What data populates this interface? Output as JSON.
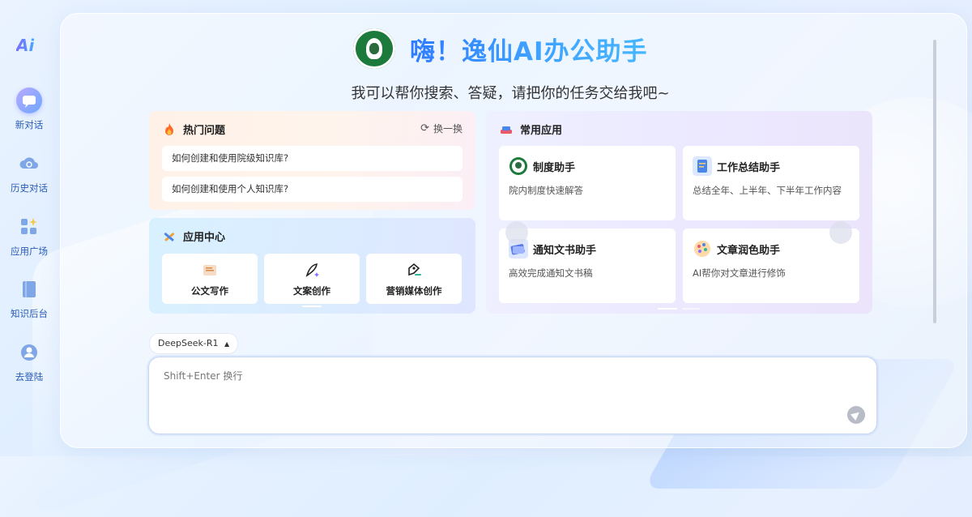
{
  "sidebar": {
    "logo": "Ai",
    "items": [
      {
        "label": "新对话",
        "icon": "chat-bubble-icon"
      },
      {
        "label": "历史对话",
        "icon": "cloud-icon"
      },
      {
        "label": "应用广场",
        "icon": "grid-sparkle-icon"
      },
      {
        "label": "知识后台",
        "icon": "book-icon"
      },
      {
        "label": "去登陆",
        "icon": "user-icon"
      }
    ]
  },
  "hero": {
    "title": "嗨！逸仙AI办公助手",
    "subtitle": "我可以帮你搜索、答疑，请把你的任务交给我吧~"
  },
  "hot": {
    "title": "热门问题",
    "refresh_label": "换一换",
    "questions": [
      "如何创建和使用院级知识库?",
      "如何创建和使用个人知识库?"
    ]
  },
  "app_center": {
    "title": "应用中心",
    "tiles": [
      {
        "label": "公文写作",
        "icon": "document-icon"
      },
      {
        "label": "文案创作",
        "icon": "pen-icon"
      },
      {
        "label": "营销媒体创作",
        "icon": "marketing-pen-icon"
      }
    ]
  },
  "common_apps": {
    "title": "常用应用",
    "tiles": [
      {
        "title": "制度助手",
        "desc": "院内制度快速解答",
        "icon": "seal-icon"
      },
      {
        "title": "工作总结助手",
        "desc": "总结全年、上半年、下半年工作内容",
        "icon": "notebook-icon"
      },
      {
        "title": "通知文书助手",
        "desc": "高效完成通知文书稿",
        "icon": "notice-icon"
      },
      {
        "title": "文章润色助手",
        "desc": "AI帮你对文章进行修饰",
        "icon": "palette-icon"
      }
    ]
  },
  "composer": {
    "model": "DeepSeek-R1",
    "placeholder": "Shift+Enter 换行"
  },
  "colors": {
    "accent": "#2d7bff",
    "brand_green": "#1d7a3d",
    "nav_text": "#2a5bb8"
  }
}
